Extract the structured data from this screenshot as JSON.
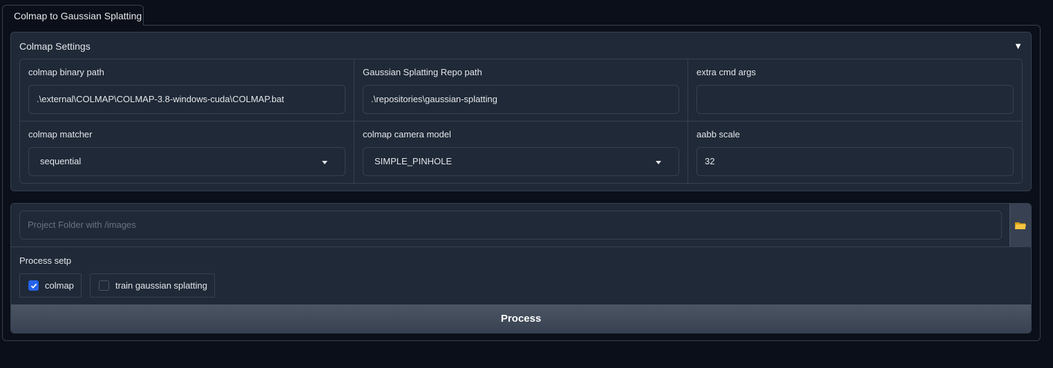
{
  "tab": {
    "label": "Colmap to Gaussian Splatting"
  },
  "settings": {
    "title": "Colmap Settings",
    "toggle": "▼",
    "binary_path": {
      "label": "colmap binary path",
      "value": ".\\external\\COLMAP\\COLMAP-3.8-windows-cuda\\COLMAP.bat"
    },
    "repo_path": {
      "label": "Gaussian Splatting Repo path",
      "value": ".\\repositories\\gaussian-splatting"
    },
    "extra_args": {
      "label": "extra cmd args",
      "value": ""
    },
    "matcher": {
      "label": "colmap matcher",
      "value": "sequential"
    },
    "camera_model": {
      "label": "colmap camera model",
      "value": "SIMPLE_PINHOLE"
    },
    "aabb_scale": {
      "label": "aabb scale",
      "value": "32"
    }
  },
  "project": {
    "placeholder": "Project Folder with /images"
  },
  "process_step": {
    "label": "Process setp",
    "options": [
      {
        "label": "colmap",
        "checked": true
      },
      {
        "label": "train gaussian splatting",
        "checked": false
      }
    ]
  },
  "process_button": {
    "label": "Process"
  },
  "colors": {
    "accent": "#2563eb",
    "background": "#0b0f19",
    "panel": "#1f2937",
    "border": "#374151"
  },
  "icons": {
    "folder": "folder-icon",
    "dropdown": "chevron-down-icon",
    "check": "check-icon"
  }
}
